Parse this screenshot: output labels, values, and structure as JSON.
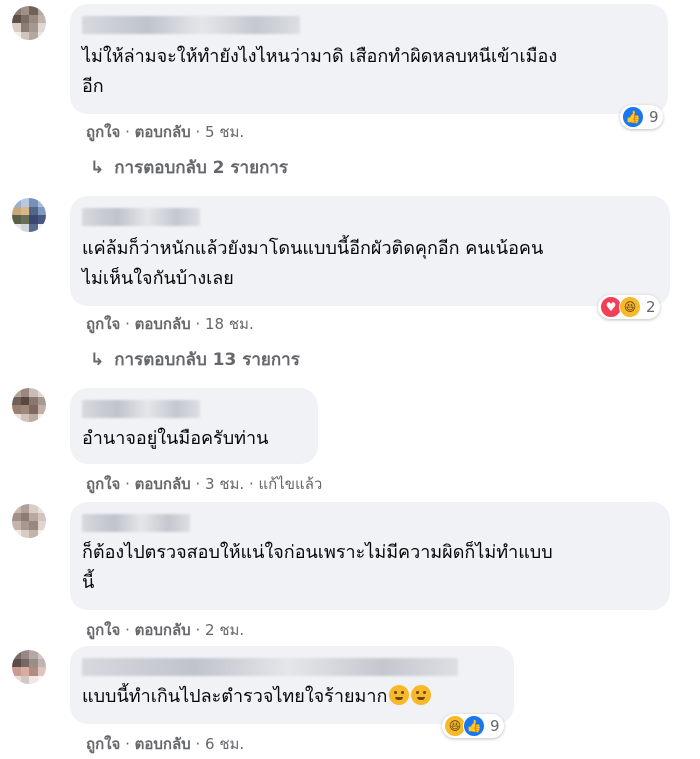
{
  "comments": [
    {
      "text": "ไม่ให้ล่ามจะให้ทำยังไงไหนว่ามาดิ เสือกทำผิดหลบหนีเข้าเมือง\nอีก",
      "like": "ถูกใจ",
      "reply": "ตอบกลับ",
      "time": "5 ชม.",
      "edited": "",
      "reactions": [
        "like-icon"
      ],
      "reaction_count": "9",
      "replies": "การตอบกลับ 2 รายการ",
      "avatar_colors": [
        "#8a7a70",
        "#a09088",
        "#6e6258",
        "#b8a8a0",
        "#5e5048",
        "#7c6c64",
        "#9a8a80",
        "#c0b4ac",
        "#d8ccc4",
        "#8c7c74",
        "#a49890",
        "#e0d8d0",
        "#f4eeea",
        "#d0c4bc",
        "#b4a8a0",
        "#ece4de"
      ]
    },
    {
      "text": "แค่ล้มก็ว่าหนักแล้วยังมาโดนแบบนี้อีกผัวติดคุกอีก คนเน้อคน\nไม่เห็นใจกันบ้างเลย",
      "like": "ถูกใจ",
      "reply": "ตอบกลับ",
      "time": "18 ชม.",
      "edited": "",
      "reactions": [
        "love-icon",
        "haha-icon"
      ],
      "reaction_count": "2",
      "replies": "การตอบกลับ 13 รายการ",
      "avatar_colors": [
        "#9ab0d0",
        "#b8c8e0",
        "#7890b8",
        "#a8bcd8",
        "#c8a878",
        "#d8b888",
        "#506888",
        "#8098c0",
        "#586048",
        "#687058",
        "#384870",
        "#485880",
        "#e8e8e8",
        "#d0d4dc",
        "#5a6a8c",
        "#f0f0f0"
      ]
    },
    {
      "text": "อำนาจอยู่ในมือครับท่าน",
      "like": "ถูกใจ",
      "reply": "ตอบกลับ",
      "time": "3 ชม.",
      "edited": "แก้ไขแล้ว",
      "reactions": [],
      "reaction_count": "",
      "replies": "",
      "avatar_colors": [
        "#b0a49c",
        "#988880",
        "#c8bcb4",
        "#e0d8d0",
        "#706058",
        "#584840",
        "#887870",
        "#a89890",
        "#988070",
        "#a08878",
        "#806860",
        "#c0b0a8",
        "#e8e0dc",
        "#d0c4bc",
        "#b8aca4",
        "#f0ece8"
      ]
    },
    {
      "text": "ก็ต้องไปตรวจสอบให้แน่ใจก่อนเพราะไม่มีความผิดก็ไม่ทำแบบ\nนี้",
      "like": "ถูกใจ",
      "reply": "ตอบกลับ",
      "time": "2 ชม.",
      "edited": "",
      "reactions": [],
      "reaction_count": "",
      "replies": "",
      "avatar_colors": [
        "#c8b8b0",
        "#b0a098",
        "#d8ccc4",
        "#e8e0da",
        "#a09088",
        "#8c7c74",
        "#b8a8a0",
        "#d0c4bc",
        "#c4b4ac",
        "#a89890",
        "#988880",
        "#e0d4cc",
        "#f0e8e4",
        "#d8ccc4",
        "#c0b4ac",
        "#f4f0ec"
      ]
    },
    {
      "text": "แบบนี้ทำเกินไปละตำรวจไทยใจร้ายมาก",
      "like": "ถูกใจ",
      "reply": "ตอบกลับ",
      "time": "6 ชม.",
      "edited": "",
      "reactions": [
        "haha-icon",
        "like-icon"
      ],
      "reaction_count": "9",
      "replies": "",
      "avatar_colors": [
        "#7c6c68",
        "#988884",
        "#b4a8a4",
        "#d0c8c4",
        "#5c4c48",
        "#786864",
        "#9c8c88",
        "#c0b4b0",
        "#c89c90",
        "#d8aca0",
        "#b08c84",
        "#e0c4bc",
        "#e8dcd8",
        "#d4c8c4",
        "#f0e8e4",
        "#f8f4f0"
      ]
    }
  ]
}
